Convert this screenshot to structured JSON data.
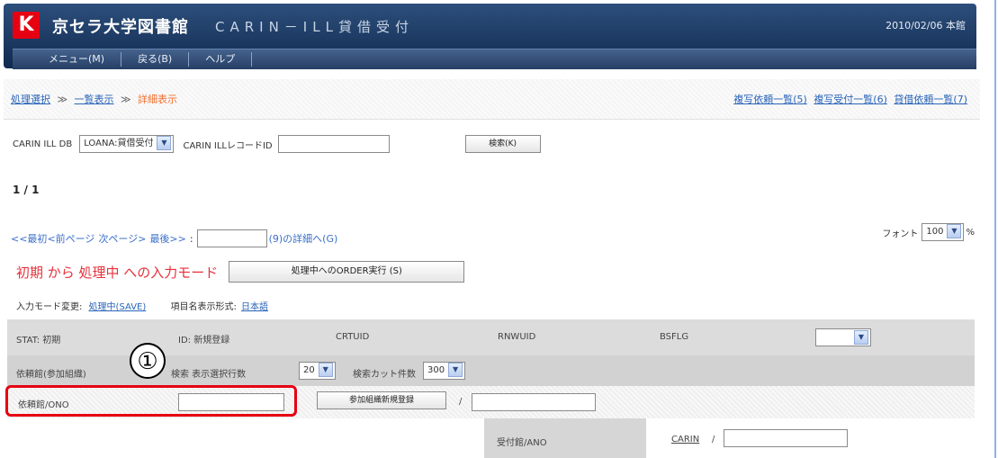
{
  "header": {
    "logo_glyph": "K",
    "library_name": "京セラ大学図書館",
    "app_title": "CARIN－ILL貸借受付",
    "date_location": "2010/02/06 本館"
  },
  "menu": [
    {
      "label": "メニュー(M)"
    },
    {
      "label": "戻る(B)"
    },
    {
      "label": "ヘルプ"
    }
  ],
  "breadcrumb": {
    "step1": "処理選択",
    "sep": "≫",
    "step2": "一覧表示",
    "current": "詳細表示"
  },
  "right_links": [
    {
      "label": "複写依頼一覧(5)"
    },
    {
      "label": "複写受付一覧(6)"
    },
    {
      "label": "貸借依頼一覧(7)"
    }
  ],
  "db_row": {
    "db_label": "CARIN ILL DB",
    "db_selected": "LOANA:貸借受付",
    "record_label": "CARIN ILLレコードID",
    "record_value": "",
    "search_button": "検索(K)"
  },
  "page_count": "1 / 1",
  "pager": {
    "first": "<<最初",
    "prev": "<前ページ",
    "next": "次ページ>",
    "last": "最後>>",
    "colon": ":",
    "jump_value": "",
    "jump_suffix": "(9)の詳細へ(G)"
  },
  "font_ctrl": {
    "label": "フォント",
    "value": "100",
    "unit": "%"
  },
  "mode": {
    "text": "初期 から 処理中 への入力モード",
    "button": "処理中へのORDER実行 (S)"
  },
  "change_row": {
    "label": "入力モード変更:",
    "mode_link": "処理中(SAVE)",
    "format_label": "項目名表示形式:",
    "format_link": "日本語"
  },
  "table": {
    "row1": {
      "stat": "STAT: 初期",
      "id": "ID: 新規登録",
      "crtuid": "CRTUID",
      "rnwuid": "RNWUID",
      "bsflg": "BSFLG",
      "bsflg_value": ""
    },
    "row2": {
      "label": "依頼館(参加組織)",
      "search_label": "検索 表示選択行数",
      "rows_value": "20",
      "cut_label": "検索カット件数",
      "cut_value": "300"
    },
    "row3": {
      "label": "依頼館/ONO",
      "register_button": "参加組織新規登録",
      "slash": "/",
      "ono_value": ""
    },
    "row4": {
      "label": "受付館/ANO",
      "carin_link": "CARIN",
      "slash": "/",
      "ano_value": ""
    }
  },
  "annotation": {
    "marker": "①"
  },
  "colors": {
    "accent_red": "#e60012",
    "link_blue": "#2a64b8",
    "mode_red": "#e8303a",
    "header_navy": "#1b3a64"
  }
}
